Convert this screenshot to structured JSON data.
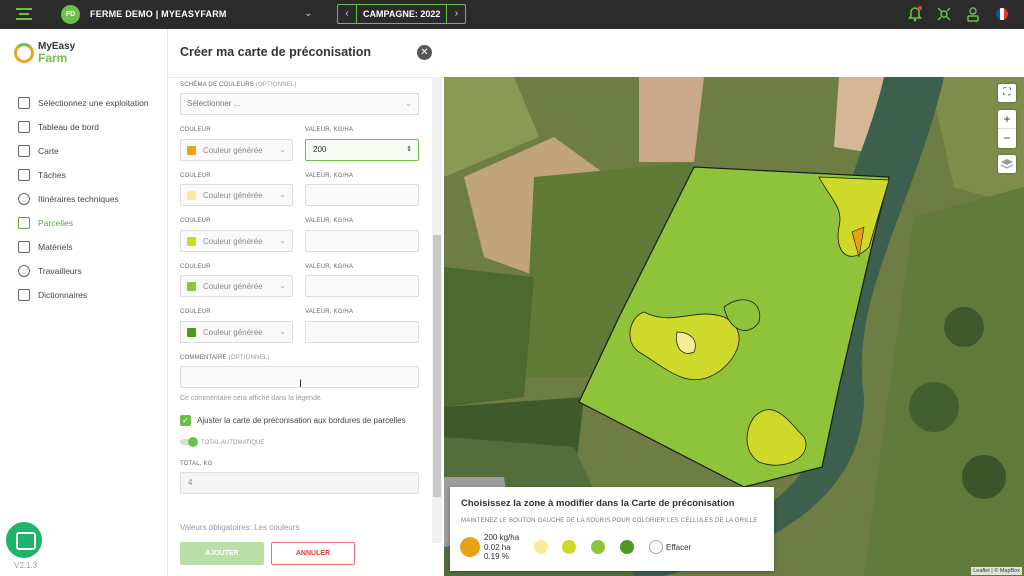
{
  "topbar": {
    "avatar": "FD",
    "farm_name": "FERME DEMO | MYEASYFARM",
    "campaign": "CAMPAGNE: 2022",
    "prev": "‹",
    "next": "›"
  },
  "sidebar": {
    "logo_line1": "MyEasy",
    "logo_line2": "Farm",
    "items": [
      {
        "label": "Sélectionnez une exploitation"
      },
      {
        "label": "Tableau de bord"
      },
      {
        "label": "Carte"
      },
      {
        "label": "Tâches"
      },
      {
        "label": "Itinéraires techniques"
      },
      {
        "label": "Parcelles"
      },
      {
        "label": "Matériels"
      },
      {
        "label": "Travailleurs"
      },
      {
        "label": "Dictionnaires"
      }
    ],
    "version": "V2.1.3"
  },
  "panel": {
    "title": "Créer ma carte de préconisation",
    "close": "✕",
    "scheme_label": "SCHÉMA DE COULEURS",
    "optional": "(OPTIONNEL)",
    "scheme_placeholder": "Sélectionner ...",
    "color_label": "COULEUR",
    "value_label": "VALEUR, KG/HA",
    "rows": [
      {
        "color_text": "Couleur générée",
        "swatch": "#e8a219",
        "value": "200"
      },
      {
        "color_text": "Couleur générée",
        "swatch": "#f5ec9a",
        "value": ""
      },
      {
        "color_text": "Couleur générée",
        "swatch": "#cfd92a",
        "value": ""
      },
      {
        "color_text": "Couleur générée",
        "swatch": "#8fc43a",
        "value": ""
      },
      {
        "color_text": "Couleur générée",
        "swatch": "#4e9a1f",
        "value": ""
      }
    ],
    "comment_label": "COMMENTAIRE",
    "comment_hint": "Ce commentaire sera affiché dans la légende.",
    "adjust_label": "Ajuster la carte de préconisation aux bordures de parcelles",
    "auto_total_label": "TOTAL AUTOMATIQUE",
    "total_label": "TOTAL, KG",
    "total_value": "4",
    "mandatory": "Valeurs obligatoires: Les couleurs",
    "add_button": "AJOUTER",
    "cancel_button": "ANNULER"
  },
  "map": {
    "zoom_in": "+",
    "zoom_out": "−",
    "attribution": "Leaflet | © MapBox",
    "legend": {
      "title": "Choisissez la zone à modifier dans la Carte de préconisation",
      "subtitle": "MAINTENEZ LE BOUTON GAUCHE DE LA SOURIS POUR COLORIER LES CELLULES DE LA GRILLE",
      "rate": "200 kg/ha",
      "area": "0.02 ha",
      "percent": "0.19 %",
      "erase": "Effacer"
    }
  },
  "colors": {
    "accent": "#6cc04a",
    "topbar": "#2b2b2b"
  }
}
